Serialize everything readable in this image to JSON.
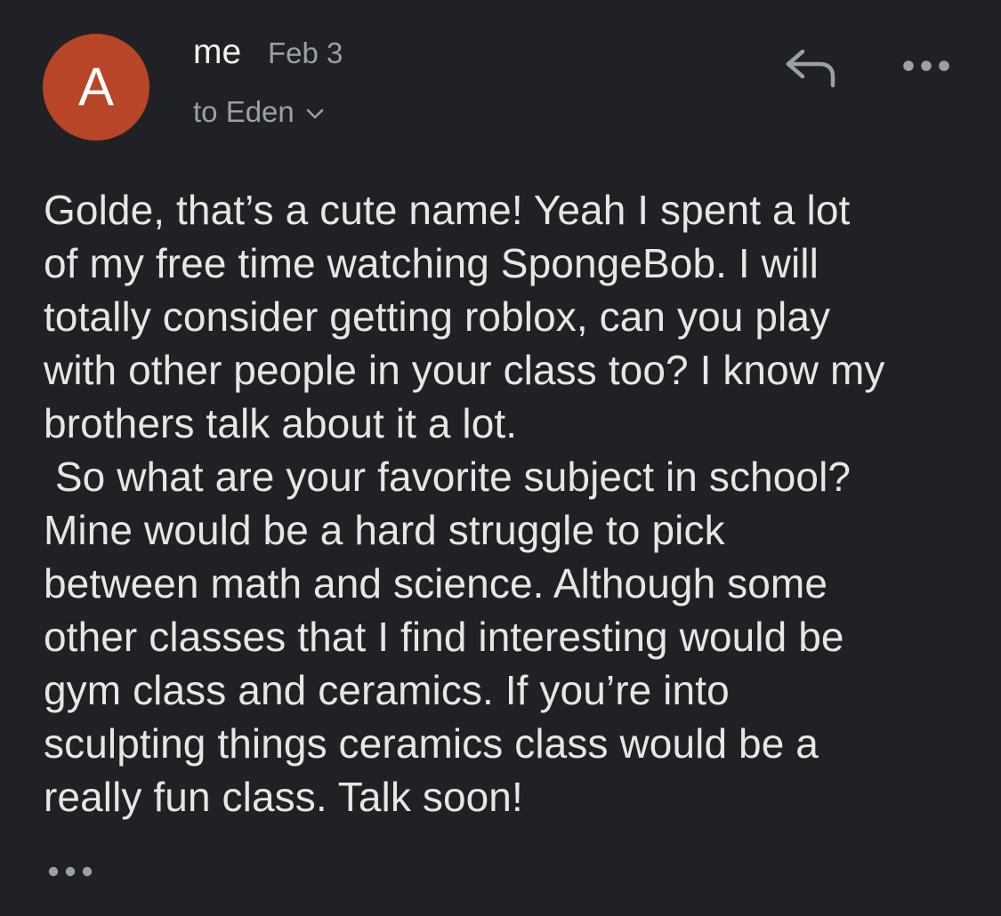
{
  "colors": {
    "background": "#202124",
    "avatar": "#b84527",
    "icon": "#9aa0a6"
  },
  "header": {
    "avatar_letter": "A",
    "sender": "me",
    "date": "Feb 3",
    "recipient": "to Eden"
  },
  "actions": {
    "reply_icon": "reply-arrow-icon",
    "more_icon": "more-horizontal-icon",
    "recipient_expand_icon": "chevron-down-icon",
    "trimmed_content_icon": "ellipsis-icon"
  },
  "message": {
    "lines": [
      "Golde, that’s a cute name! Yeah I spent a lot",
      "of my free time watching SpongeBob. I will",
      "totally consider getting roblox, can you play",
      "with other people in your class too? I know my",
      "brothers talk about it a lot.",
      " So what are your favorite subject in school?",
      "Mine would be a hard struggle to pick",
      "between math and science. Although some",
      "other classes that I find interesting would be",
      "gym class and ceramics. If you’re into",
      "sculpting things ceramics class would be a",
      "really fun class. Talk soon!"
    ]
  }
}
